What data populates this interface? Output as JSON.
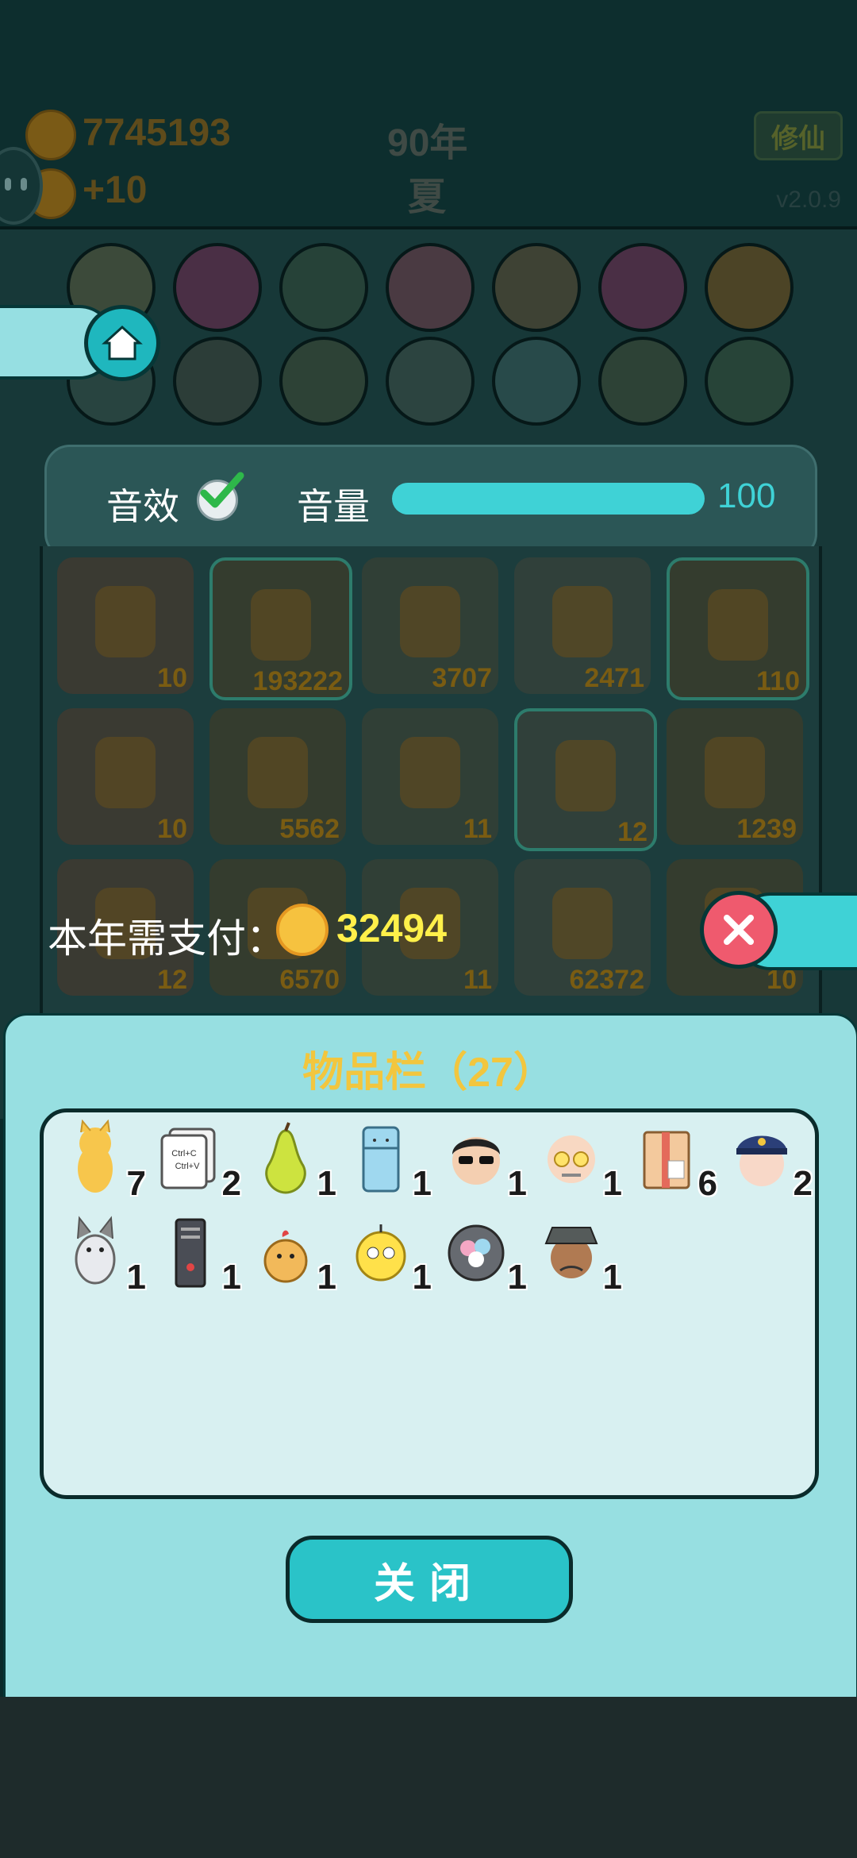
{
  "header": {
    "coins": "7745193",
    "income": "+10",
    "year": "90年",
    "season": "夏",
    "cultivate_label": "修仙",
    "version": "v2.0.9"
  },
  "settings": {
    "sound_label": "音效",
    "volume_label": "音量",
    "volume_value": "100",
    "volume": 1.0
  },
  "grid_counts": [
    "10",
    "193222",
    "3707",
    "2471",
    "110",
    "10",
    "5562",
    "11",
    "12",
    "1239",
    "12",
    "6570",
    "11",
    "62372",
    "10"
  ],
  "payment": {
    "label": "本年需支付：",
    "amount": "32494"
  },
  "panel": {
    "title": "物品栏（27）",
    "close_label": "关闭",
    "items": [
      {
        "icon": "cat-icon",
        "count": "7"
      },
      {
        "icon": "ctrl-c-v-card-icon",
        "count": "2"
      },
      {
        "icon": "pear-icon",
        "count": "1"
      },
      {
        "icon": "fridge-icon",
        "count": "1"
      },
      {
        "icon": "sunglasses-man-icon",
        "count": "1"
      },
      {
        "icon": "bald-man-glasses-icon",
        "count": "1"
      },
      {
        "icon": "package-icon",
        "count": "6"
      },
      {
        "icon": "police-icon",
        "count": "2"
      },
      {
        "icon": "husky-icon",
        "count": "1"
      },
      {
        "icon": "pc-tower-icon",
        "count": "1"
      },
      {
        "icon": "chick-icon",
        "count": "1"
      },
      {
        "icon": "yellow-chick-icon",
        "count": "1"
      },
      {
        "icon": "bowl-icon",
        "count": "1"
      },
      {
        "icon": "hat-man-icon",
        "count": "1"
      }
    ]
  },
  "colors": {
    "accent": "#2ac3c8",
    "panel_bg": "#97dfe1",
    "title": "#f2c63e",
    "payment_amount": "#fff04a",
    "close_red": "#ef5a6e"
  }
}
